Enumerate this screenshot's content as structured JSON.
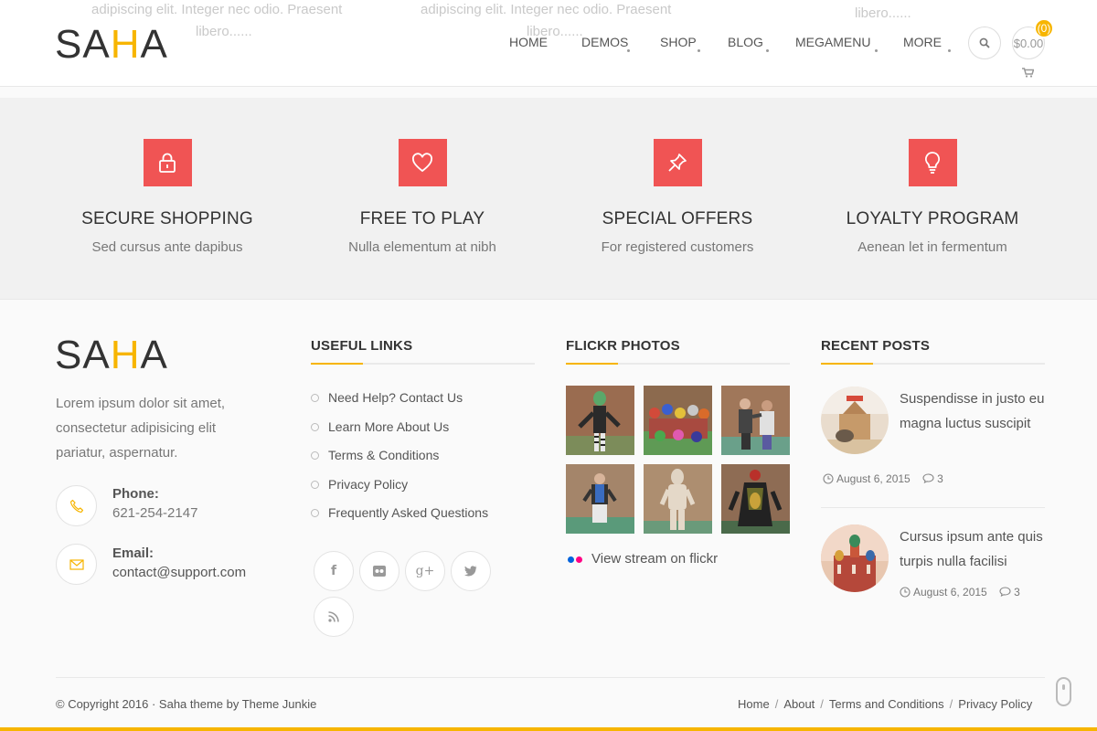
{
  "header": {
    "ghost_text": [
      "adipiscing elit. Integer nec odio. Praesent",
      "libero......",
      "adipiscing elit. Integer nec odio. Praesent",
      "libero......",
      "libero......"
    ],
    "logo": {
      "part1": "SA",
      "part2": "H",
      "part3": "A"
    },
    "nav": [
      "HOME",
      "DEMOS",
      "SHOP",
      "BLOG",
      "MEGAMENU",
      "MORE"
    ],
    "cart": {
      "total": "$0.00",
      "count": "(0)"
    }
  },
  "features": [
    {
      "title": "SECURE SHOPPING",
      "subtitle": "Sed cursus ante dapibus",
      "icon": "lock-icon"
    },
    {
      "title": "FREE TO PLAY",
      "subtitle": "Nulla elementum at nibh",
      "icon": "heart-icon"
    },
    {
      "title": "SPECIAL OFFERS",
      "subtitle": "For registered customers",
      "icon": "pin-icon"
    },
    {
      "title": "LOYALTY PROGRAM",
      "subtitle": "Aenean let in fermentum",
      "icon": "lightbulb-icon"
    }
  ],
  "about": {
    "logo": {
      "part1": "SA",
      "part2": "H",
      "part3": "A"
    },
    "text": "Lorem ipsum dolor sit amet, consectetur adipisicing elit pariatur, aspernatur.",
    "phone_label": "Phone:",
    "phone_value": "621-254-2147",
    "email_label": "Email:",
    "email_value": "contact@support.com"
  },
  "useful_links": {
    "title": "USEFUL LINKS",
    "items": [
      "Need Help? Contact Us",
      "Learn More About Us",
      "Terms & Conditions",
      "Privacy Policy",
      "Frequently Asked Questions"
    ],
    "social": [
      "facebook-icon",
      "flickr-icon",
      "google-plus-icon",
      "twitter-icon",
      "rss-icon"
    ]
  },
  "flickr": {
    "title": "FLICKR PHOTOS",
    "link": "View stream on flickr"
  },
  "recent_posts": {
    "title": "RECENT POSTS",
    "posts": [
      {
        "title": "Suspendisse in justo eu magna luctus suscipit",
        "date": "August 6, 2015",
        "comments": "3"
      },
      {
        "title": "Cursus ipsum ante quis turpis nulla facilisi",
        "date": "August 6, 2015",
        "comments": "3"
      }
    ]
  },
  "bottom": {
    "copyright": "© Copyright 2016 · Saha theme by Theme Junkie",
    "links": [
      "Home",
      "About",
      "Terms and Conditions",
      "Privacy Policy"
    ]
  },
  "colors": {
    "accent": "#f7b500",
    "feature": "#f05454"
  }
}
